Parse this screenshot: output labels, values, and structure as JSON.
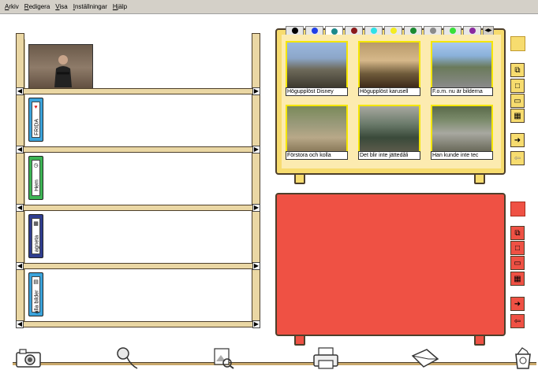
{
  "menu": [
    "Arkiv",
    "Redigera",
    "Visa",
    "Inställningar",
    "Hjälp"
  ],
  "binders": [
    {
      "label": "FRIDA",
      "color": "#3aa3db"
    },
    {
      "label": "Hem",
      "color": "#3cb454"
    },
    {
      "label": "agneta",
      "color": "#2f3d8f"
    },
    {
      "label": "alla bilder",
      "color": "#3aa3db"
    }
  ],
  "photos": [
    {
      "caption": "Högupplöst Disney"
    },
    {
      "caption": "Högupplöst karusell"
    },
    {
      "caption": "F.o.m. nu är bilderna"
    },
    {
      "caption": "Förstora och kolla"
    },
    {
      "caption": "Det blir inte jättedåli"
    },
    {
      "caption": "Han kunde inte tec"
    }
  ],
  "colors": {
    "table_yellow": "#f7dc6f",
    "table_red": "#ef5144"
  }
}
